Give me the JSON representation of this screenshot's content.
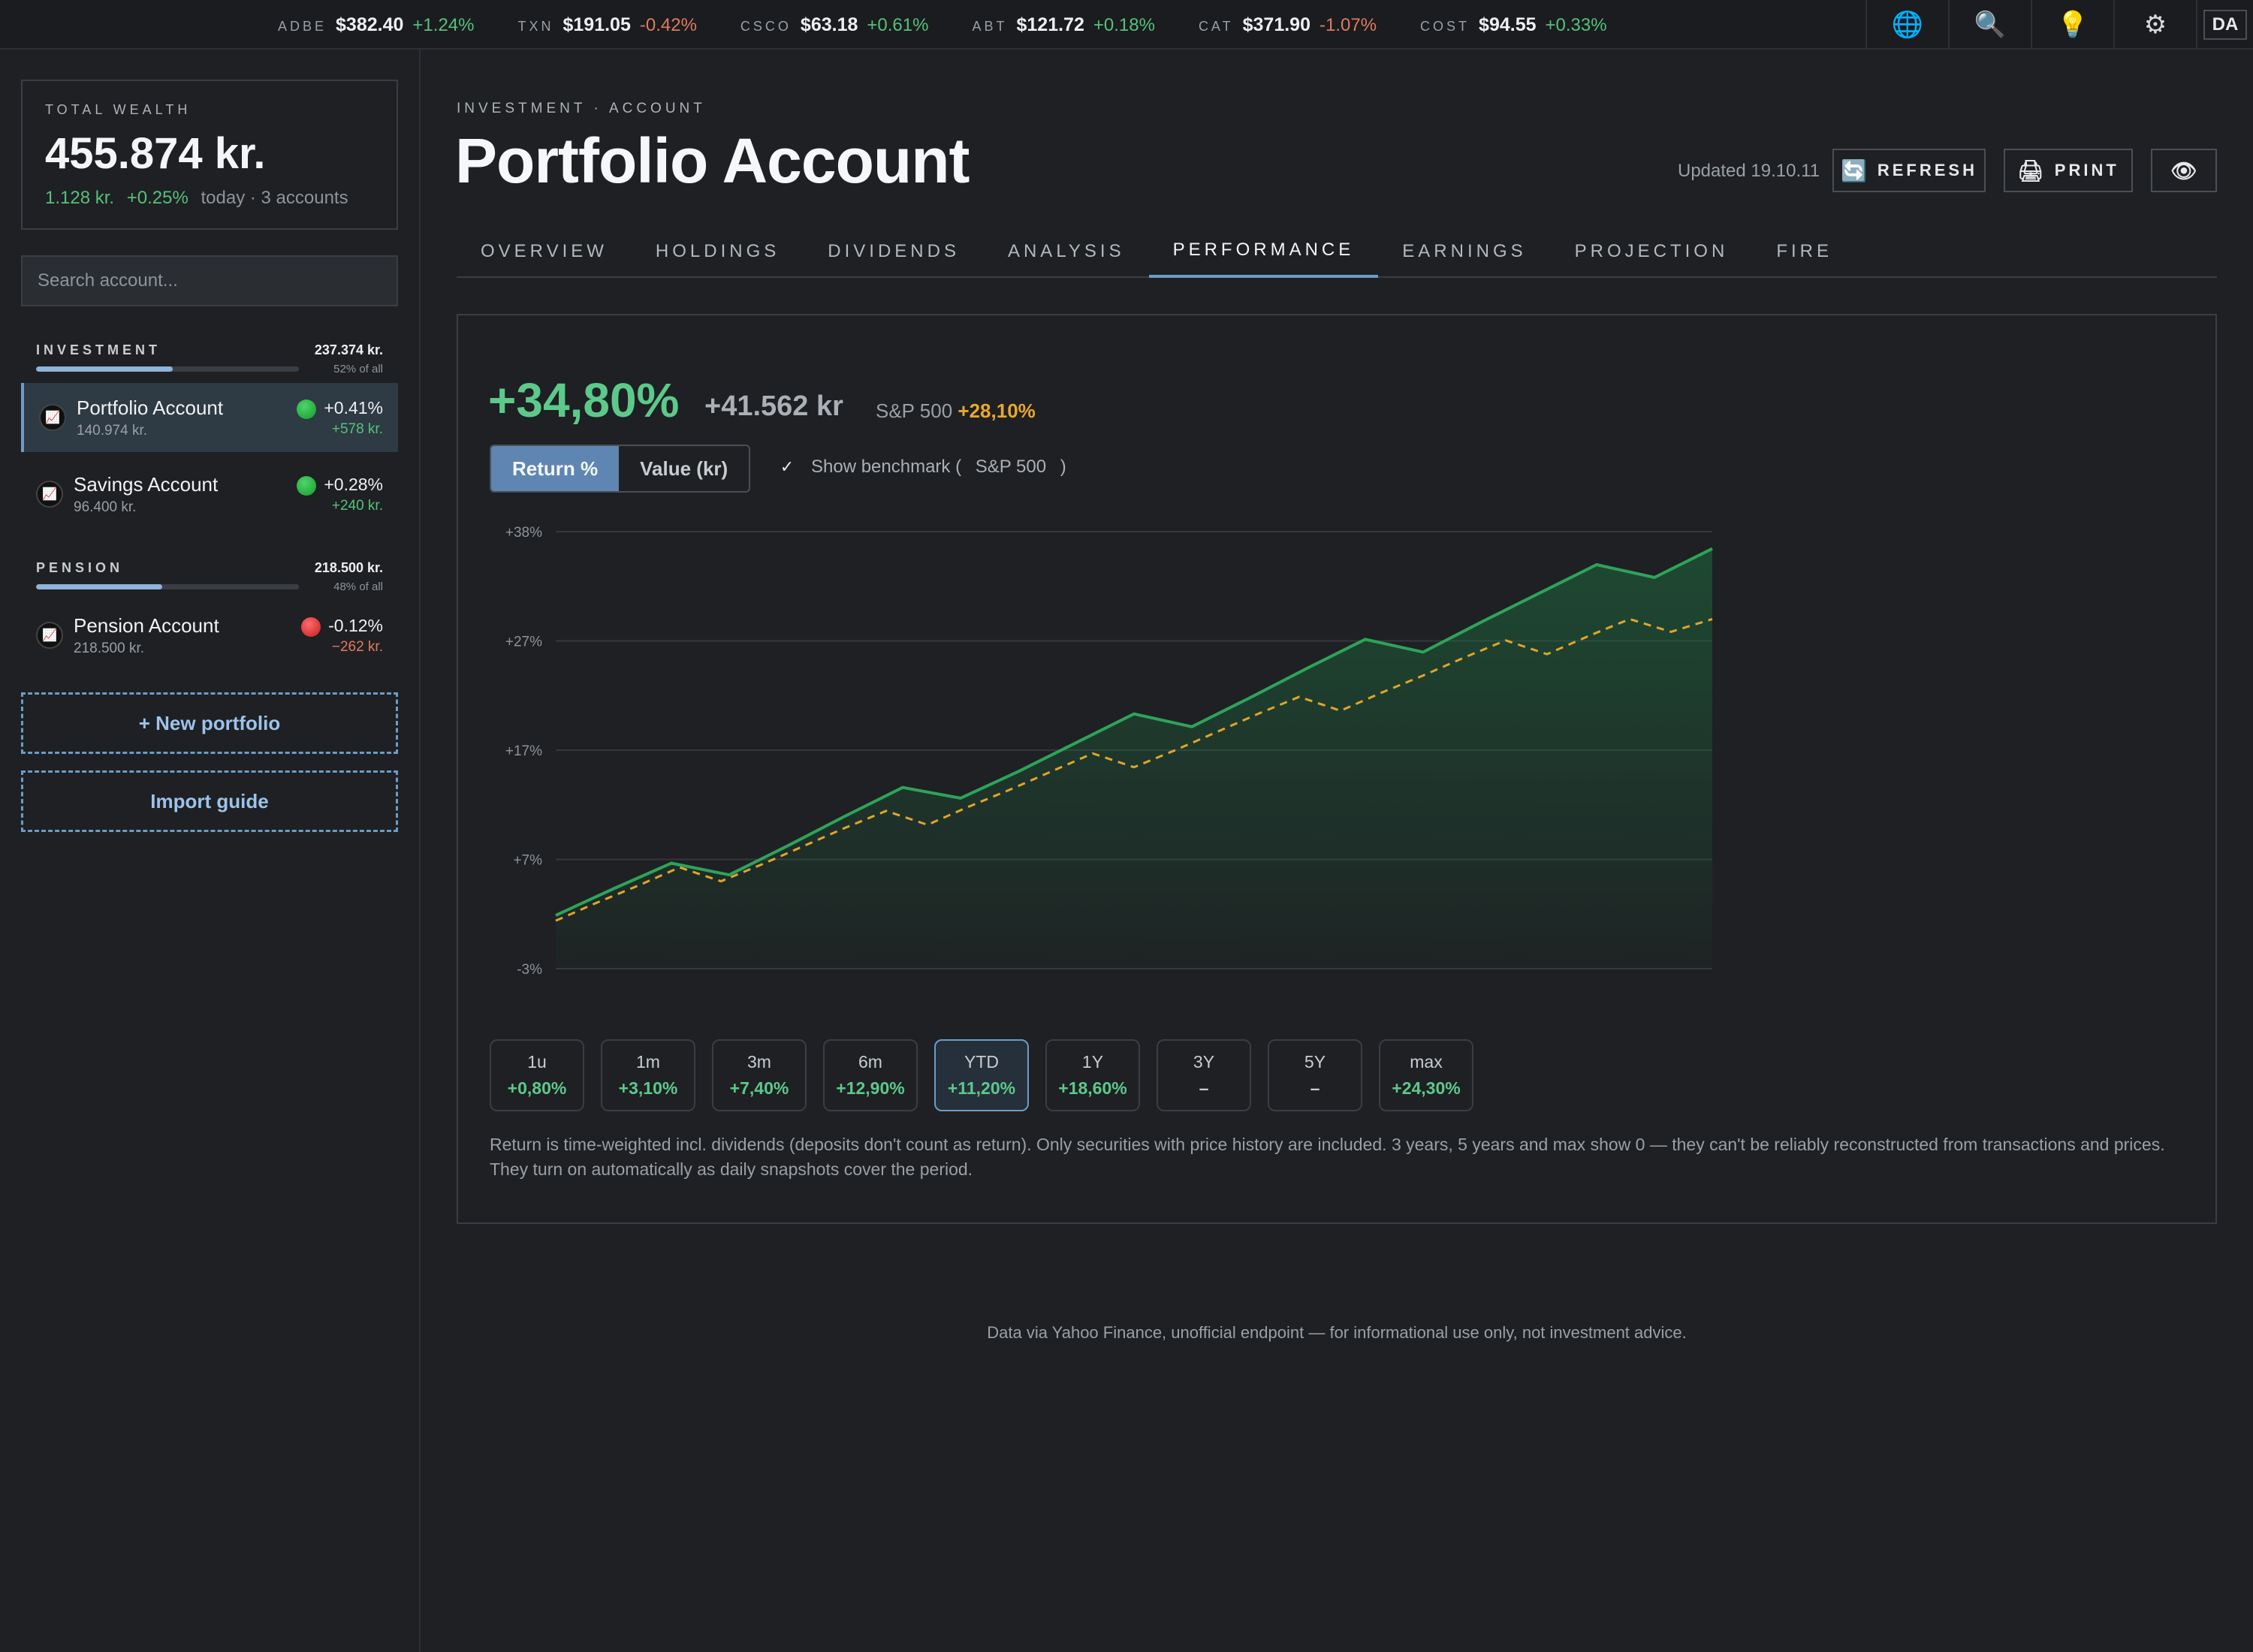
{
  "ticker": [
    {
      "symbol": "ADBE",
      "price": "$382.40",
      "change": "+1.24%",
      "dir": "up"
    },
    {
      "symbol": "TXN",
      "price": "$191.05",
      "change": "-0.42%",
      "dir": "down"
    },
    {
      "symbol": "CSCO",
      "price": "$63.18",
      "change": "+0.61%",
      "dir": "up"
    },
    {
      "symbol": "ABT",
      "price": "$121.72",
      "change": "+0.18%",
      "dir": "up"
    },
    {
      "symbol": "CAT",
      "price": "$371.90",
      "change": "-1.07%",
      "dir": "down"
    },
    {
      "symbol": "COST",
      "price": "$94.55",
      "change": "+0.33%",
      "dir": "up"
    }
  ],
  "topbar": {
    "icons": [
      "globe-icon",
      "search-icon",
      "lightbulb-icon",
      "gear-icon"
    ],
    "user_initials": "DA"
  },
  "sidebar": {
    "total_label": "TOTAL WEALTH",
    "total_value": "455.874 kr.",
    "total_change_abs": "1.128 kr.",
    "total_change_pct": "+0.25%",
    "total_change_note": "today · 3 accounts",
    "search_placeholder": "Search account...",
    "groups": [
      {
        "name": "INVESTMENT",
        "value": "237.374 kr.",
        "share_label": "52% of all",
        "share": 0.52,
        "accounts": [
          {
            "name": "Portfolio Account",
            "value": "140.974 kr.",
            "pct": "+0.41%",
            "abs": "+578 kr.",
            "status": "up"
          },
          {
            "name": "Savings Account",
            "value": "96.400 kr.",
            "pct": "+0.28%",
            "abs": "+240 kr.",
            "status": "up"
          }
        ]
      },
      {
        "name": "PENSION",
        "value": "218.500 kr.",
        "share_label": "48% of all",
        "share": 0.48,
        "accounts": [
          {
            "name": "Pension Account",
            "value": "218.500 kr.",
            "pct": "-0.12%",
            "abs": "−262 kr.",
            "status": "down"
          }
        ]
      }
    ],
    "new_portfolio_label": "+ New portfolio",
    "import_label": "Import guide"
  },
  "header": {
    "breadcrumb": "INVESTMENT · ACCOUNT",
    "title": "Portfolio Account",
    "updated": "Updated 19.10.11",
    "refresh_label": "REFRESH",
    "print_label": "PRINT"
  },
  "tabs": [
    "OVERVIEW",
    "HOLDINGS",
    "DIVIDENDS",
    "ANALYSIS",
    "PERFORMANCE",
    "EARNINGS",
    "PROJECTION",
    "FIRE"
  ],
  "active_tab": "PERFORMANCE",
  "performance": {
    "return_pct": "+34,80%",
    "return_abs": "+41.562 kr",
    "benchmark_label": "S&P 500",
    "benchmark_value": "+28,10%",
    "toggle": [
      "Return %",
      "Value (kr)"
    ],
    "toggle_active": "Return %",
    "show_benchmark_label": "Show benchmark (",
    "benchmark_name": "S&P 500",
    "show_benchmark_close": ")",
    "show_benchmark_checked": true,
    "ranges": [
      {
        "label": "1u",
        "value": "+0,80%"
      },
      {
        "label": "1m",
        "value": "+3,10%"
      },
      {
        "label": "3m",
        "value": "+7,40%"
      },
      {
        "label": "6m",
        "value": "+12,90%"
      },
      {
        "label": "YTD",
        "value": "+11,20%",
        "active": true
      },
      {
        "label": "1Y",
        "value": "+18,60%"
      },
      {
        "label": "3Y",
        "value": "–"
      },
      {
        "label": "5Y",
        "value": "–"
      },
      {
        "label": "max",
        "value": "+24,30%"
      }
    ],
    "note": "Return is time-weighted incl. dividends (deposits don't count as return). Only securities with price history are included. 3 years, 5 years and max show 0 — they can't be reliably reconstructed from transactions and prices. They turn on automatically as daily snapshots cover the period."
  },
  "chart_data": {
    "type": "area",
    "title": "",
    "xlabel": "",
    "ylabel": "",
    "yticks": [
      "+38%",
      "+27%",
      "+17%",
      "+7%",
      "-3%"
    ],
    "ylim": [
      -3,
      38
    ],
    "grid": true,
    "series": [
      {
        "values": [
          2.0,
          4.5,
          6.9,
          5.8,
          8.5,
          11.3,
          14.0,
          13.0,
          15.5,
          18.2,
          20.9,
          19.7,
          22.4,
          25.2,
          27.9,
          26.7,
          29.5,
          32.2,
          34.9,
          33.7,
          36.4
        ],
        "color": "#2ea35a"
      },
      {
        "values": [
          1.5,
          3.2,
          4.8,
          6.5,
          5.2,
          6.8,
          8.5,
          10.2,
          11.8,
          10.5,
          12.2,
          13.8,
          15.5,
          17.2,
          15.9,
          17.5,
          19.2,
          20.9,
          22.5,
          21.2,
          22.9,
          24.5,
          26.2,
          27.8,
          26.5,
          28.2,
          29.8,
          28.6,
          29.8
        ],
        "color": "#e0a52a",
        "dashed": true
      }
    ],
    "colors": {
      "primary": "#2ea35a",
      "benchmark": "#e0a52a"
    }
  },
  "footer": "Data via Yahoo Finance, unofficial endpoint — for informational use only, not investment advice."
}
